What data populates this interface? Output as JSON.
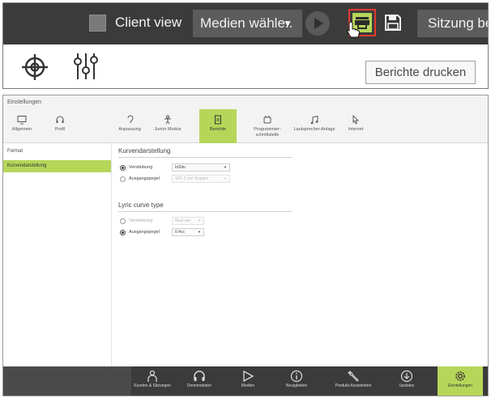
{
  "snippet": {
    "client_view_label": "Client view",
    "medien_dropdown": "Medien wähle..",
    "sitzung_button": "Sitzung be",
    "tooltip": "Berichte drucken",
    "icons": {
      "client_view_checkbox": "checkbox-icon",
      "play": "play-icon",
      "print": "print-icon",
      "save": "save-icon",
      "crosshair": "crosshair-icon",
      "sliders": "sliders-icon",
      "cursor": "hand-cursor-icon"
    },
    "colors": {
      "toolbar_bg": "#3b3b3b",
      "accent_green": "#b6d65a",
      "highlight_red": "#e23b2e"
    }
  },
  "window": {
    "title": "Einstellungen",
    "tabs": [
      {
        "label": "Allgemein",
        "icon": "monitor-icon",
        "active": false
      },
      {
        "label": "Profil",
        "icon": "headset-icon",
        "active": false
      },
      {
        "label": "Anpassung",
        "icon": "ear-icon",
        "active": false
      },
      {
        "label": "Junior Modus",
        "icon": "child-icon",
        "active": false
      },
      {
        "label": "Berichte",
        "icon": "report-icon",
        "active": true
      },
      {
        "label": "Programmier-schnittstelle",
        "icon": "interface-icon",
        "active": false
      },
      {
        "label": "Lautsprecher-Anlage",
        "icon": "music-icon",
        "active": false
      },
      {
        "label": "Internet",
        "icon": "cursor-icon",
        "active": false
      }
    ],
    "sidebar": [
      {
        "label": "Format",
        "active": false
      },
      {
        "label": "Kurvendarstellung",
        "active": true
      }
    ],
    "sections": [
      {
        "title": "Kurvendarstellung",
        "options": [
          {
            "label": "Verstärkung",
            "selected": true,
            "value": "InSitu",
            "enabled": true
          },
          {
            "label": "Ausgangspegel",
            "selected": false,
            "value": "SPL 2 cm³ Koppler",
            "enabled": false
          }
        ]
      },
      {
        "title": "Lyric curve type",
        "options": [
          {
            "label": "Verstärkung",
            "selected": false,
            "value": "Real ear",
            "enabled": false
          },
          {
            "label": "Ausgangspegel",
            "selected": true,
            "value": "0.4cc",
            "enabled": true
          }
        ]
      }
    ]
  },
  "bottom_nav": [
    {
      "label": "Kunden & Sitzungen",
      "icon": "person-icon",
      "active": false
    },
    {
      "label": "Demonstrator",
      "icon": "headphones-icon",
      "active": false
    },
    {
      "label": "Medien",
      "icon": "play-icon",
      "active": false
    },
    {
      "label": "Neuigkeiten",
      "icon": "info-icon",
      "active": false
    },
    {
      "label": "Produkt-Assistenten",
      "icon": "wrench-icon",
      "active": false
    },
    {
      "label": "Updates",
      "icon": "download-icon",
      "active": false
    },
    {
      "label": "Einstellungen",
      "icon": "gear-icon",
      "active": true
    }
  ]
}
